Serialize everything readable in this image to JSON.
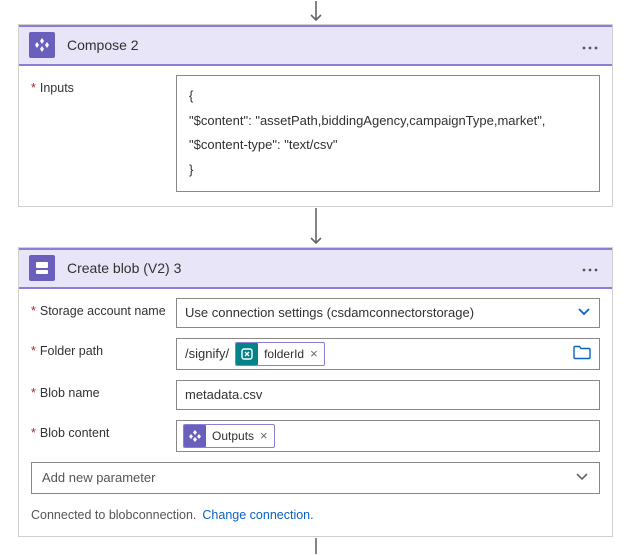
{
  "compose": {
    "title": "Compose 2",
    "inputs_label": "Inputs",
    "inputs_value": "{\n\"$content\": \"assetPath,biddingAgency,campaignType,market\",\n\"$content-type\": \"text/csv\"\n}"
  },
  "blob": {
    "title": "Create blob (V2) 3",
    "storage_label": "Storage account name",
    "storage_value": "Use connection settings (csdamconnectorstorage)",
    "folder_label": "Folder path",
    "folder_prefix": "/signify/",
    "folder_token": "folderId",
    "blobname_label": "Blob name",
    "blobname_value": "metadata.csv",
    "blobcontent_label": "Blob content",
    "blobcontent_token": "Outputs",
    "add_param": "Add new parameter",
    "footer_text": "Connected to blobconnection.",
    "footer_link": "Change connection."
  }
}
